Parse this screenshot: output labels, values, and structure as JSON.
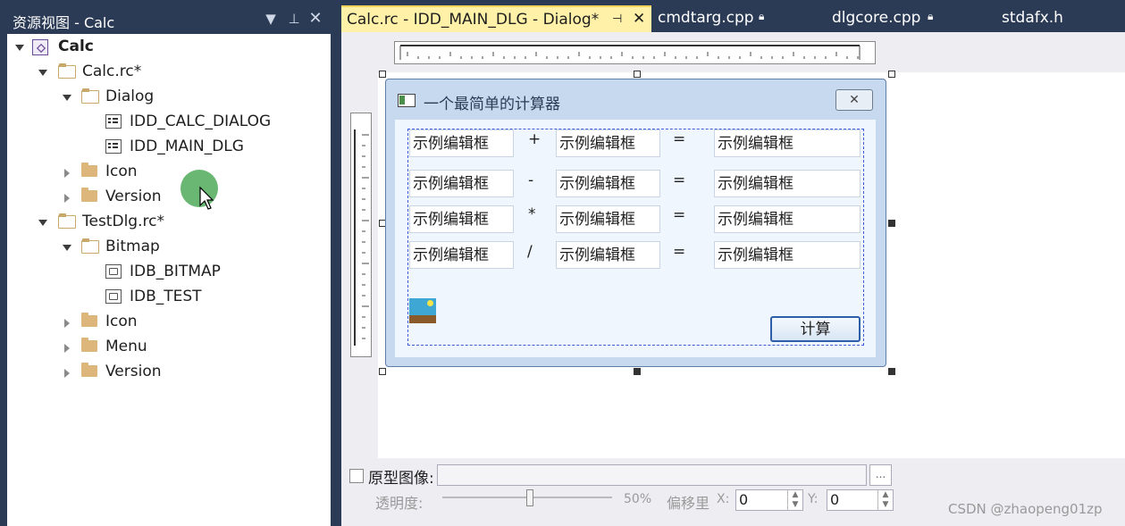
{
  "left_panel": {
    "title": "资源视图 - Calc",
    "tree": {
      "root": "Calc",
      "calc_rc": "Calc.rc*",
      "dialog_folder": "Dialog",
      "idd_calc": "IDD_CALC_DIALOG",
      "idd_main": "IDD_MAIN_DLG",
      "icon_folder_1": "Icon",
      "version_folder_1": "Version",
      "testdlg_rc": "TestDlg.rc*",
      "bitmap_folder": "Bitmap",
      "idb_bitmap": "IDB_BITMAP",
      "idb_test": "IDB_TEST",
      "icon_folder_2": "Icon",
      "menu_folder": "Menu",
      "version_folder_2": "Version"
    }
  },
  "tabs": [
    {
      "label": "Calc.rc - IDD_MAIN_DLG - Dialog*",
      "active": true
    },
    {
      "label": "cmdtarg.cpp",
      "active": false
    },
    {
      "label": "dlgcore.cpp",
      "active": false
    },
    {
      "label": "stdafx.h",
      "active": false
    }
  ],
  "dialog": {
    "title": "一个最简单的计算器",
    "edit_placeholder": "示例编辑框",
    "operators": [
      "+",
      "-",
      "*",
      "/"
    ],
    "equals": "=",
    "calc_button": "计算"
  },
  "toolbar": {
    "proto_label": "原型图像:",
    "browse_label": "...",
    "opacity_label": "透明度:",
    "opacity_value": "50%",
    "offset_label": "偏移里",
    "x_label": "X:",
    "x_value": "0",
    "y_label": "Y:",
    "y_value": "0"
  },
  "watermark": "CSDN @zhaopeng01zp",
  "colors": {
    "panel_bg": "#2b3a55",
    "active_tab": "#fff1a8",
    "dialog_frame": "#c6d9ef",
    "selection": "#3b5cd6"
  }
}
